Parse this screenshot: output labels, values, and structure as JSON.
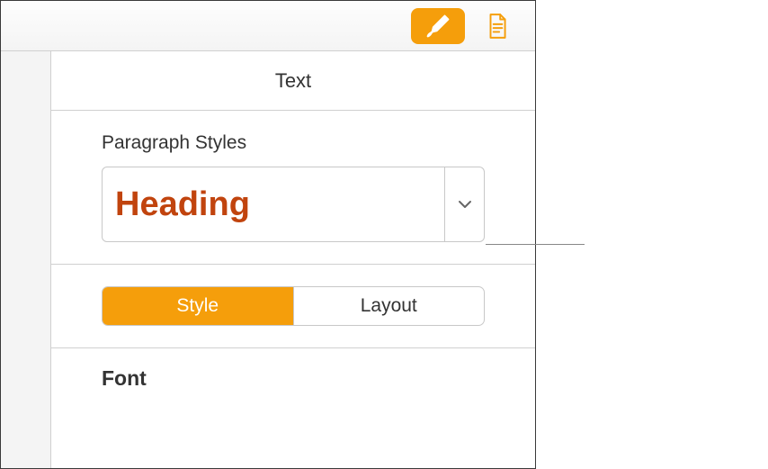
{
  "toolbar": {
    "format_icon": "brush",
    "document_icon": "document"
  },
  "panel": {
    "title": "Text"
  },
  "paragraph_styles": {
    "label": "Paragraph Styles",
    "selected": "Heading"
  },
  "tabs": {
    "style": "Style",
    "layout": "Layout"
  },
  "font": {
    "label": "Font"
  }
}
